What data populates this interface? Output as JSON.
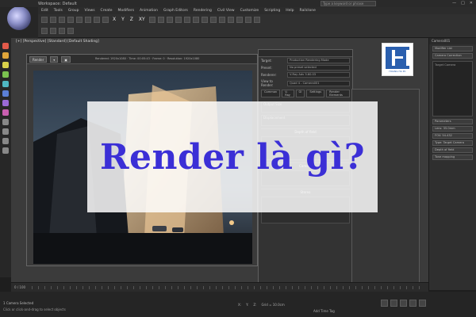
{
  "window": {
    "title": "Workspace: Default",
    "search_placeholder": "Type a keyword or phrase",
    "controls": [
      "—",
      "□",
      "✕"
    ]
  },
  "menu": [
    "Edit",
    "Tools",
    "Group",
    "Views",
    "Create",
    "Modifiers",
    "Animation",
    "Graph Editors",
    "Rendering",
    "Civil View",
    "Customize",
    "Scripting",
    "Help",
    "Railclone"
  ],
  "toolbar": {
    "axes": [
      "X",
      "Y",
      "Z",
      "XY"
    ]
  },
  "viewport": {
    "label": "[+] [Perspective] [Standard] [Default Shading]"
  },
  "frame_window": {
    "render_button": "Render",
    "info": "Rendered: 1920x1080  ·  Time: 00:05:43  ·  Frame: 0  ·  Resolution: 1920x1080"
  },
  "render_setup": {
    "fields": [
      {
        "label": "Target:",
        "value": "Production Rendering Mode"
      },
      {
        "label": "Preset:",
        "value": "No preset selected"
      },
      {
        "label": "Renderer:",
        "value": "V-Ray Adv 3.60.03"
      },
      {
        "label": "View to Render:",
        "value": "Quad 4 - Camera001"
      }
    ],
    "tabs": [
      "Common",
      "V-Ray",
      "GI",
      "Settings",
      "Render Elements"
    ],
    "sections": [
      "Output Size",
      "Displacement",
      "Depth of field",
      "Camera",
      "Stereo"
    ]
  },
  "command_panel": {
    "header": "Camera001",
    "items": [
      "Modifier List",
      "Camera Correction",
      "Target Camera"
    ],
    "list_label": "Target Camera",
    "params": [
      "Parameters",
      "Lens: 35.0mm",
      "FOV: 54.432",
      "Type: Target Camera",
      "Depth of field",
      "Tone mapping"
    ]
  },
  "brand": {
    "text": "HOANG HA PC"
  },
  "timeline": {
    "frames": "0 / 100"
  },
  "status": {
    "selected": "1 Camera Selected",
    "hint": "Click or click-and-drag to select objects",
    "coords": [
      "X:",
      "Y:",
      "Z:",
      "Grid = 10.0cm"
    ],
    "add_tag": "Add Time Tag"
  },
  "overlay": {
    "headline": "Render là gì?"
  },
  "colors": {
    "headline": "#3b2fd6",
    "ui_dark": "#2f2f2f",
    "brand_blue": "#2a5fae"
  }
}
